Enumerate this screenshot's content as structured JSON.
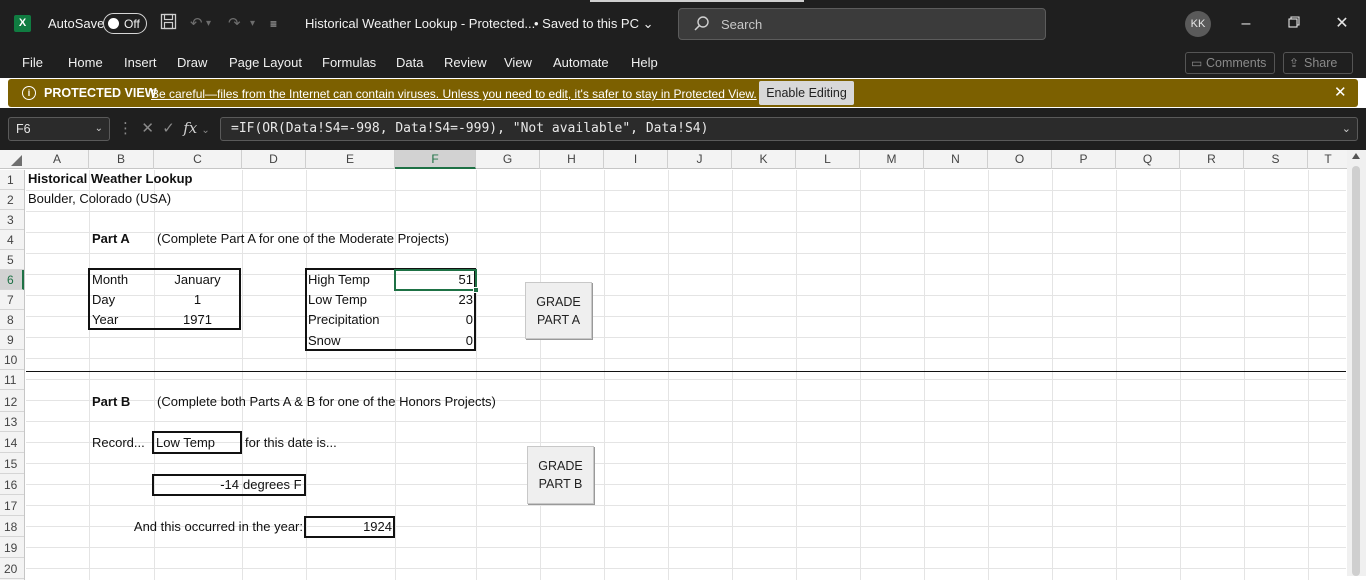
{
  "titlebar": {
    "app_icon_letter": "X",
    "autosave_label": "AutoSave",
    "autosave_state": "Off",
    "doc_title": "Historical Weather Lookup  -  Protected...",
    "save_status": "• Saved to this PC ⌄",
    "search_placeholder": "Search",
    "user_initials": "KK"
  },
  "menu": {
    "items": [
      "File",
      "Home",
      "Insert",
      "Draw",
      "Page Layout",
      "Formulas",
      "Data",
      "Review",
      "View",
      "Automate",
      "Help"
    ],
    "comments_label": "Comments",
    "share_label": "Share"
  },
  "protected_view": {
    "title": "PROTECTED VIEW",
    "message": "Be careful—files from the Internet can contain viruses. Unless you need to edit, it's safer to stay in Protected View.",
    "enable_button": "Enable Editing"
  },
  "formula_bar": {
    "name_box": "F6",
    "formula": "=IF(OR(Data!S4=-998, Data!S4=-999), \"Not available\", Data!S4)"
  },
  "grid": {
    "columns": [
      "A",
      "B",
      "C",
      "D",
      "E",
      "F",
      "G",
      "H",
      "I",
      "J",
      "K",
      "L",
      "M",
      "N",
      "O",
      "P",
      "Q",
      "R",
      "S",
      "T"
    ],
    "rows": [
      "1",
      "2",
      "3",
      "4",
      "5",
      "6",
      "7",
      "8",
      "9",
      "10",
      "11",
      "12",
      "13",
      "14",
      "15",
      "16",
      "17",
      "18",
      "19",
      "20"
    ],
    "selected_column": "F",
    "selected_row": "6"
  },
  "cells": {
    "title": "Historical Weather Lookup",
    "location": "Boulder, Colorado (USA)",
    "part_a_label": "Part A",
    "part_a_desc": "(Complete Part A for one of the Moderate Projects)",
    "month_label": "Month",
    "month_value": "January",
    "day_label": "Day",
    "day_value": "1",
    "year_label": "Year",
    "year_value": "1971",
    "high_label": "High Temp",
    "high_value": "51",
    "low_label": "Low Temp",
    "low_value": "23",
    "precip_label": "Precipitation",
    "precip_value": "0",
    "snow_label": "Snow",
    "snow_value": "0",
    "grade_a": "GRADE\nPART A",
    "part_b_label": "Part B",
    "part_b_desc": "(Complete both Parts A & B for one of the Honors Projects)",
    "record_label": "Record...",
    "record_type": "Low Temp",
    "record_suffix": "for this date is...",
    "record_value": "-14",
    "record_unit": "degrees F",
    "grade_b": "GRADE\nPART B",
    "year_prompt": "And this occurred in the year:",
    "year_result": "1924"
  }
}
